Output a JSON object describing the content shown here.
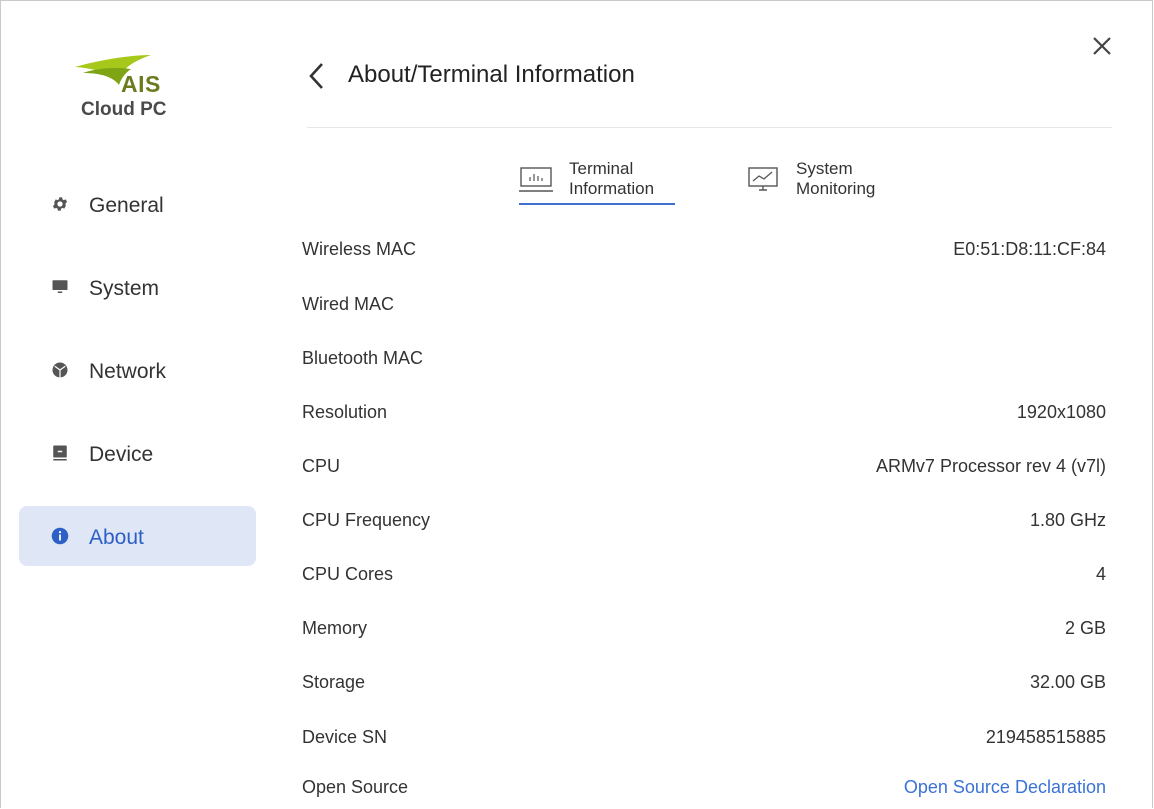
{
  "logo": {
    "brand": "AIS",
    "product": "Cloud PC",
    "colors": {
      "green": "#9bc21b",
      "olive": "#6d7b1f"
    }
  },
  "sidebar": {
    "items": [
      {
        "label": "General",
        "icon": "gear-icon",
        "active": false
      },
      {
        "label": "System",
        "icon": "monitor-icon",
        "active": false
      },
      {
        "label": "Network",
        "icon": "network-globe-icon",
        "active": false
      },
      {
        "label": "Device",
        "icon": "device-icon",
        "active": false
      },
      {
        "label": "About",
        "icon": "info-icon",
        "active": true
      }
    ]
  },
  "header": {
    "title": "About/Terminal Information",
    "back_icon": "chevron-left-icon",
    "close_icon": "close-icon"
  },
  "tabs": [
    {
      "line1": "Terminal",
      "line2": "Information",
      "icon": "chart-icon",
      "selected": true
    },
    {
      "line1": "System",
      "line2": "Monitoring",
      "icon": "monitor-chart-icon",
      "selected": false
    }
  ],
  "info": [
    {
      "key": "Wireless MAC",
      "value": "E0:51:D8:11:CF:84"
    },
    {
      "key": "Wired MAC",
      "value": ""
    },
    {
      "key": "Bluetooth MAC",
      "value": ""
    },
    {
      "key": "Resolution",
      "value": "1920x1080"
    },
    {
      "key": "CPU",
      "value": "ARMv7 Processor rev 4 (v7l)"
    },
    {
      "key": "CPU Frequency",
      "value": "1.80 GHz"
    },
    {
      "key": "CPU Cores",
      "value": "4"
    },
    {
      "key": "Memory",
      "value": "2 GB"
    },
    {
      "key": "Storage",
      "value": "32.00 GB"
    },
    {
      "key": "Device SN",
      "value": "219458515885"
    },
    {
      "key": "Open Source",
      "value": "Open Source Declaration",
      "link": true
    }
  ],
  "colors": {
    "accent": "#3f6fd1",
    "active_bg": "#dfe6f5",
    "link": "#3a72d8"
  }
}
